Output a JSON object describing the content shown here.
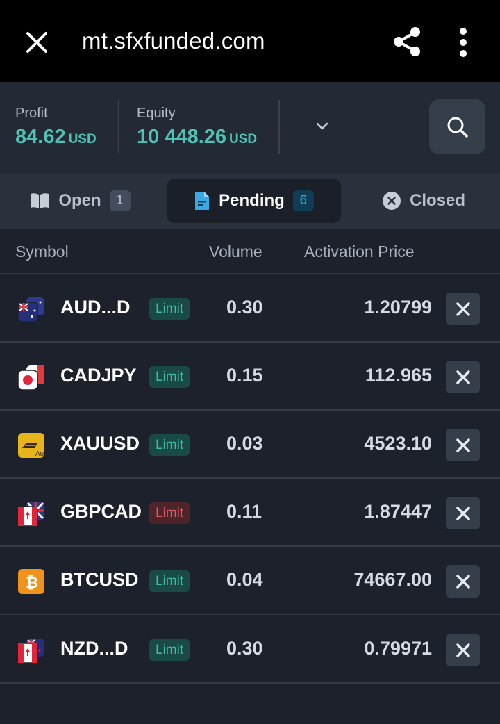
{
  "browser": {
    "url": "mt.sfxfunded.com",
    "close_icon": "close-icon",
    "share_icon": "share-icon",
    "more_icon": "more-vertical-icon"
  },
  "account": {
    "profit_label": "Profit",
    "profit_value": "84.62",
    "profit_currency": "USD",
    "equity_label": "Equity",
    "equity_value": "10 448.26",
    "equity_currency": "USD",
    "accent_color": "#4fc2b4"
  },
  "tabs": [
    {
      "label": "Open",
      "count": "1",
      "icon": "book-icon"
    },
    {
      "label": "Pending",
      "count": "6",
      "icon": "document-icon"
    },
    {
      "label": "Closed",
      "icon": "x-circle-icon"
    }
  ],
  "table": {
    "headers": [
      "Symbol",
      "Volume",
      "Activation Price"
    ],
    "rows": [
      {
        "symbol": "AUD...D",
        "type": "Limit",
        "side": "buy",
        "volume": "0.30",
        "price": "1.20799",
        "icon": "aud-flag-icon"
      },
      {
        "symbol": "CADJPY",
        "type": "Limit",
        "side": "buy",
        "volume": "0.15",
        "price": "112.965",
        "icon": "jpy-flag-icon"
      },
      {
        "symbol": "XAUUSD",
        "type": "Limit",
        "side": "buy",
        "volume": "0.03",
        "price": "4523.10",
        "icon": "gold-bar-icon"
      },
      {
        "symbol": "GBPCAD",
        "type": "Limit",
        "side": "sell",
        "volume": "0.11",
        "price": "1.87447",
        "icon": "cad-flag-icon"
      },
      {
        "symbol": "BTCUSD",
        "type": "Limit",
        "side": "buy",
        "volume": "0.04",
        "price": "74667.00",
        "icon": "bitcoin-icon"
      },
      {
        "symbol": "NZD...D",
        "type": "Limit",
        "side": "buy",
        "volume": "0.30",
        "price": "0.79971",
        "icon": "cad-flag-icon"
      }
    ]
  }
}
